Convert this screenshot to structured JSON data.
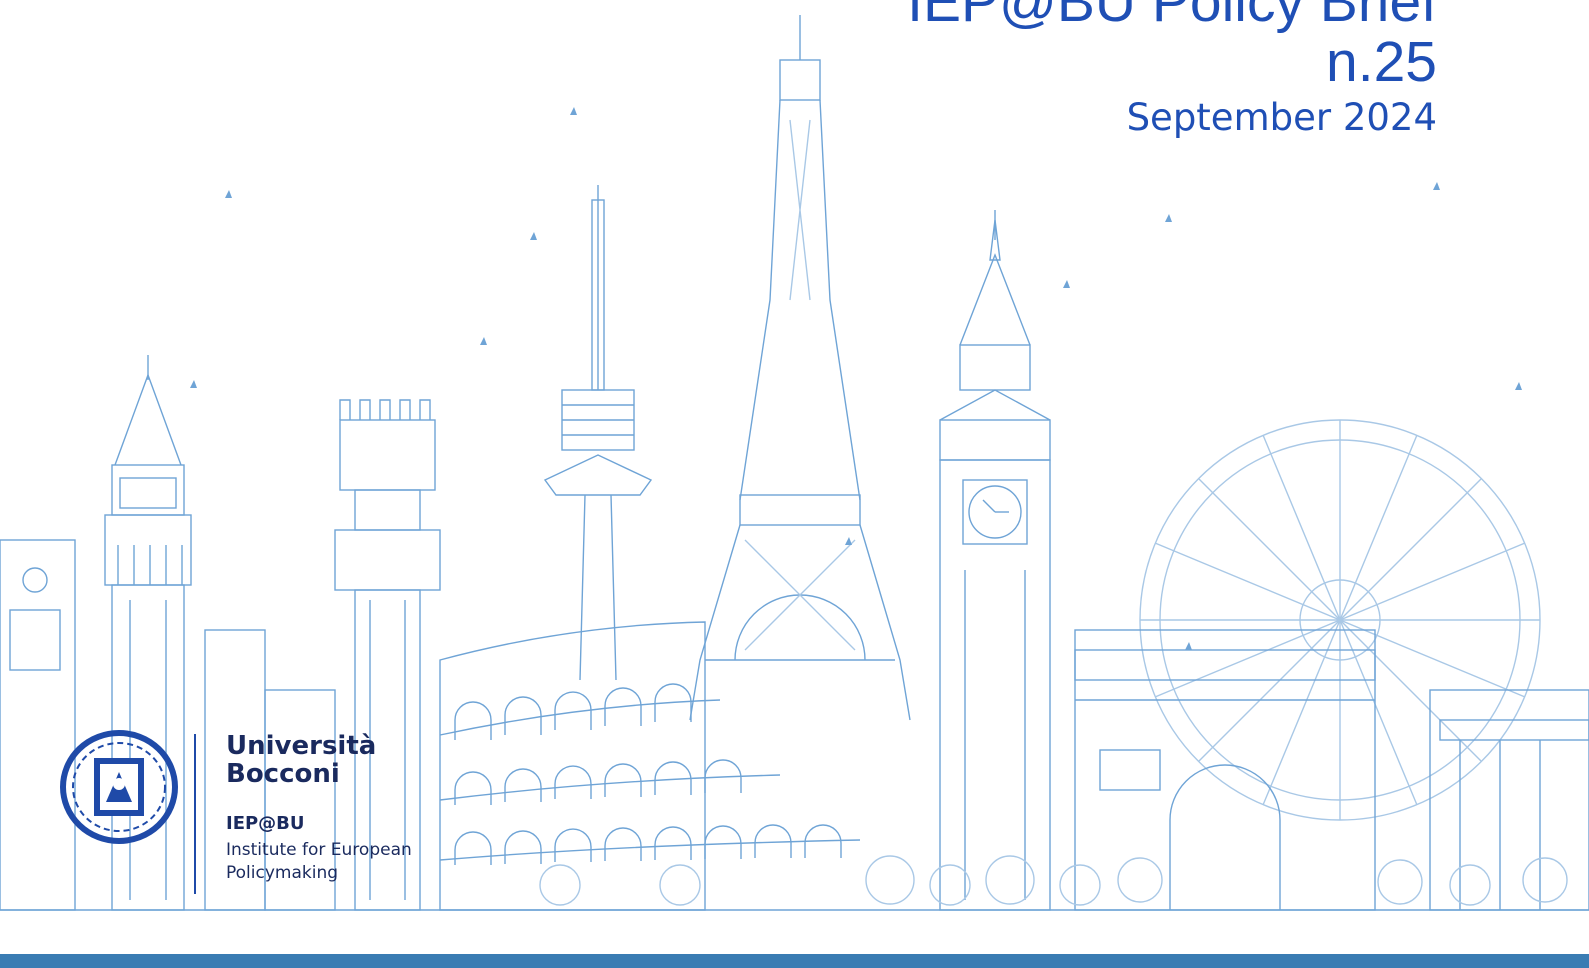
{
  "cover": {
    "title": "IEP@BU Policy Brief",
    "number": "n.25",
    "date": "September 2024"
  },
  "logo": {
    "university": [
      "Università",
      "Bocconi"
    ],
    "institute_abbr": "IEP@BU",
    "institute_name": [
      "Institute for European",
      "Policymaking"
    ]
  },
  "colors": {
    "title": "#1f4fb5",
    "logo": "#1a2a5e",
    "skyline_line": "#6fa4d6",
    "ground": "#3a7cb3"
  },
  "icons": [
    "bocconi-seal-icon",
    "bird-icon"
  ]
}
